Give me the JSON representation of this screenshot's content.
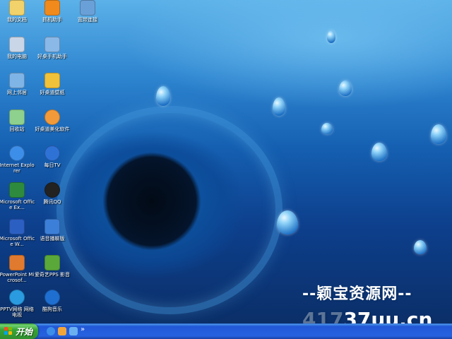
{
  "desktop": {
    "icons": [
      {
        "label": "我的文档",
        "name": "my-documents",
        "glyph": "folder-icon",
        "color": "#f2d26a"
      },
      {
        "label": "我的电脑",
        "name": "my-computer",
        "glyph": "computer-icon",
        "color": "#c9d6e8"
      },
      {
        "label": "网上邻居",
        "name": "network-places",
        "glyph": "network-icon",
        "color": "#7fb4e6"
      },
      {
        "label": "回收站",
        "name": "recycle-bin",
        "glyph": "recycle-bin-icon",
        "color": "#8ed08e"
      },
      {
        "label": "Internet Explorer",
        "name": "internet-explorer",
        "glyph": "ie-icon",
        "color": "#3d8ee8"
      },
      {
        "label": "Microsoft Office Ex...",
        "name": "office-excel",
        "glyph": "excel-icon",
        "color": "#2e8b3e"
      },
      {
        "label": "Microsoft Office W...",
        "name": "office-word",
        "glyph": "word-icon",
        "color": "#2c5fc2"
      },
      {
        "label": "PowerPoint Microsof...",
        "name": "office-powerpoint",
        "glyph": "powerpoint-icon",
        "color": "#e07a2e"
      },
      {
        "label": "PPTV网络 网络电视",
        "name": "pptv",
        "glyph": "pptv-icon",
        "color": "#2a9be0"
      },
      {
        "label": "抓机助手",
        "name": "phone-assistant-app",
        "glyph": "app-icon",
        "color": "#f08a1d"
      },
      {
        "label": "好桌手机助手",
        "name": "mobile-assistant",
        "glyph": "phone-icon",
        "color": "#8ab9e8"
      },
      {
        "label": "好桌道壁纸",
        "name": "wallpaper-app",
        "glyph": "wallpaper-icon",
        "color": "#f0c23a"
      },
      {
        "label": "好桌道美化软件",
        "name": "beautify-app",
        "glyph": "beautify-icon",
        "color": "#f29a3a"
      },
      {
        "label": "每日TV",
        "name": "daily-tv",
        "glyph": "tv-icon",
        "color": "#2f72d6"
      },
      {
        "label": "腾讯QQ",
        "name": "tencent-qq",
        "glyph": "qq-icon",
        "color": "#222222"
      },
      {
        "label": "语音播聊版",
        "name": "voice-chat",
        "glyph": "voice-icon",
        "color": "#3c7fd8"
      },
      {
        "label": "爱奇艺PPS 影音",
        "name": "iqiyi-pps",
        "glyph": "pps-icon",
        "color": "#5aa83a"
      },
      {
        "label": "酷狗音乐",
        "name": "kugou-music",
        "glyph": "kugou-icon",
        "color": "#1f6fd1"
      },
      {
        "label": "宽带连接",
        "name": "broadband-connection",
        "glyph": "broadband-icon",
        "color": "#6aa0d8"
      }
    ]
  },
  "taskbar": {
    "start_label": "开始",
    "quick_launch": [
      {
        "name": "ie-quicklaunch-icon",
        "color": "#3d8ee8"
      },
      {
        "name": "media-player-quicklaunch-icon",
        "color": "#f2a53a"
      },
      {
        "name": "show-desktop-quicklaunch-icon",
        "color": "#6ab0f0"
      }
    ],
    "more_label": "»"
  },
  "watermark": {
    "line1": "--颖宝资源网--",
    "line2_prefix": "417",
    "line2_main": "37uu.cn"
  }
}
